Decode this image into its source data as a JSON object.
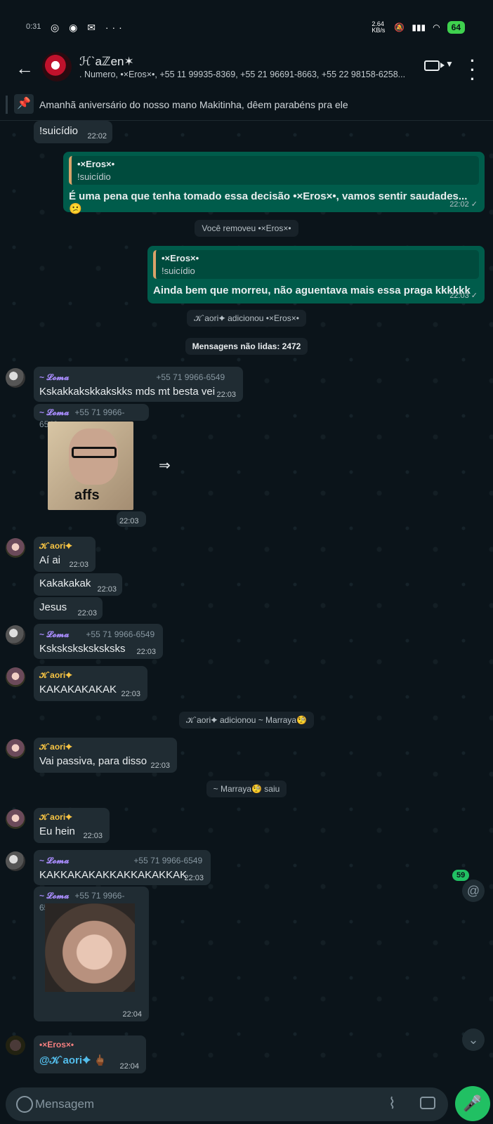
{
  "status": {
    "time": "0:31",
    "icons": "◎ ◉ ✉ ···",
    "net": "2.64 KB/s",
    "battery": "64"
  },
  "header": {
    "title": "ℋ`aℤen✶",
    "subtitle": ". Numero, •×Eros×•, +55 11 99935-8369, +55 21 96691-8663, +55 22 98158-6258..."
  },
  "pinned": {
    "text": "Amanhã aniversário do nosso mano Makitinha, dêem parabéns pra ele"
  },
  "messages": {
    "m0": {
      "text": "!suicídio",
      "time": "22:02"
    },
    "m1": {
      "quote_name": "•×Eros×•",
      "quote_text": "!suicídio",
      "text": "É uma pena que tenha tomado essa decisão •×Eros×•, vamos sentir saudades... 😕",
      "time": "22:02 ✓"
    },
    "s1": "Você removeu •×Eros×•",
    "m2": {
      "quote_name": "•×Eros×•",
      "quote_text": "!suicídio",
      "text": "Ainda bem que morreu, não aguentava mais essa praga kkkkkk",
      "time": "22:03 ✓"
    },
    "s2": "𝒦`aori✦ adicionou •×Eros×•",
    "unread": "Mensagens não lidas: 2472",
    "m3": {
      "sender": "~ 𝓛𝓸𝓶𝓪",
      "phone": "+55 71 9966-6549",
      "text": "Kskakkakskkakskks mds mt besta vei",
      "time": "22:03"
    },
    "m4": {
      "sender": "~ 𝓛𝓸𝓶𝓪",
      "phone": "+55 71 9966-6549",
      "sticker_text": "affs",
      "time": "22:03"
    },
    "m5": {
      "sender": "𝒦`aori✦",
      "text": "Aí ai",
      "time": "22:03"
    },
    "m6": {
      "text": "Kakakakak",
      "time": "22:03"
    },
    "m7": {
      "text": "Jesus",
      "time": "22:03"
    },
    "m8": {
      "sender": "~ 𝓛𝓸𝓶𝓪",
      "phone": "+55 71 9966-6549",
      "text": "Ksksksksksksksks",
      "time": "22:03"
    },
    "m9": {
      "sender": "𝒦`aori✦",
      "text": "KAKAKAKAKAK",
      "time": "22:03"
    },
    "s3": "𝒦`aori✦ adicionou ~ Marraya🧐",
    "m10": {
      "sender": "𝒦`aori✦",
      "text": "Vai passiva, para disso",
      "time": "22:03"
    },
    "s4": "~ Marraya🧐 saiu",
    "m11": {
      "sender": "𝒦`aori✦",
      "text": "Eu hein",
      "time": "22:03"
    },
    "m12": {
      "sender": "~ 𝓛𝓸𝓶𝓪",
      "phone": "+55 71 9966-6549",
      "text": "KAKKAKAKAKKAKKAKAKKAK",
      "time": "22:03"
    },
    "m13": {
      "sender": "~ 𝓛𝓸𝓶𝓪",
      "phone": "+55 71 9966-6549",
      "time": "22:04"
    },
    "m14": {
      "sender": "•×Eros×•",
      "mention": "@𝒦`aori✦",
      "emoji": "🖕🏾",
      "time": "22:04"
    }
  },
  "badges": {
    "mentions": "59"
  },
  "composer": {
    "placeholder": "Mensagem"
  },
  "colors": {
    "accent": "#21c063",
    "outgoing": "#005c4b",
    "incoming": "#202c33",
    "loma": "#a78bfa",
    "kaori": "#f6c343",
    "eros": "#f47f7f"
  }
}
